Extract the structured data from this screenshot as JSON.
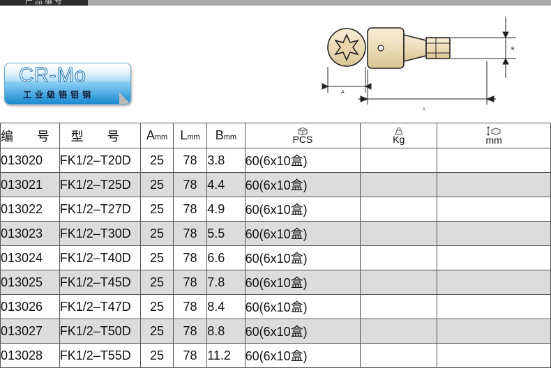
{
  "banner": {
    "text": "产品编号"
  },
  "badge": {
    "logo": "CR-Mo",
    "subtitle": "工业级铬钼钢"
  },
  "drawing": {
    "label_a": "A",
    "label_b": "B",
    "label_l": "L"
  },
  "table": {
    "headers": {
      "code": "编 号",
      "model": "型 号",
      "a": "A",
      "a_unit": "mm",
      "l": "L",
      "l_unit": "mm",
      "b": "B",
      "b_unit": "mm",
      "pcs": "PCS",
      "kg": "Kg",
      "mm": "mm"
    },
    "rows": [
      {
        "code": "013020",
        "model": "FK1/2–T20D",
        "a": "25",
        "l": "78",
        "b": "3.8",
        "pcs": "60(6x10盒)",
        "kg": "",
        "mm": ""
      },
      {
        "code": "013021",
        "model": "FK1/2–T25D",
        "a": "25",
        "l": "78",
        "b": "4.4",
        "pcs": "60(6x10盒)",
        "kg": "",
        "mm": ""
      },
      {
        "code": "013022",
        "model": "FK1/2–T27D",
        "a": "25",
        "l": "78",
        "b": "4.9",
        "pcs": "60(6x10盒)",
        "kg": "",
        "mm": ""
      },
      {
        "code": "013023",
        "model": "FK1/2–T30D",
        "a": "25",
        "l": "78",
        "b": "5.5",
        "pcs": "60(6x10盒)",
        "kg": "",
        "mm": ""
      },
      {
        "code": "013024",
        "model": "FK1/2–T40D",
        "a": "25",
        "l": "78",
        "b": "6.6",
        "pcs": "60(6x10盒)",
        "kg": "",
        "mm": ""
      },
      {
        "code": "013025",
        "model": "FK1/2–T45D",
        "a": "25",
        "l": "78",
        "b": "7.8",
        "pcs": "60(6x10盒)",
        "kg": "",
        "mm": ""
      },
      {
        "code": "013026",
        "model": "FK1/2–T47D",
        "a": "25",
        "l": "78",
        "b": "8.4",
        "pcs": "60(6x10盒)",
        "kg": "",
        "mm": ""
      },
      {
        "code": "013027",
        "model": "FK1/2–T50D",
        "a": "25",
        "l": "78",
        "b": "8.8",
        "pcs": "60(6x10盒)",
        "kg": "",
        "mm": ""
      },
      {
        "code": "013028",
        "model": "FK1/2–T55D",
        "a": "25",
        "l": "78",
        "b": "11.2",
        "pcs": "60(6x10盒)",
        "kg": "",
        "mm": ""
      }
    ]
  }
}
